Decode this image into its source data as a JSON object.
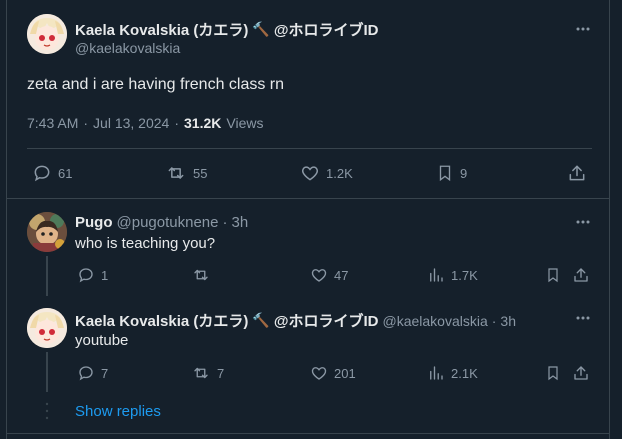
{
  "main_tweet": {
    "display_name": "Kaela Kovalskia (カエラ)",
    "name_emoji": "🔨",
    "affiliation": "@ホロライブID",
    "handle": "@kaelakovalskia",
    "text": "zeta and i are having french class rn",
    "time": "7:43 AM",
    "separator": "·",
    "date": "Jul 13, 2024",
    "views_count": "31.2K",
    "views_label": "Views",
    "stats": {
      "replies": "61",
      "reposts": "55",
      "likes": "1.2K",
      "bookmarks": "9"
    }
  },
  "replies": [
    {
      "display_name": "Pugo",
      "handle": "@pugotuknene",
      "separator": "·",
      "time_ago": "3h",
      "text": "who is teaching you?",
      "stats": {
        "replies": "1",
        "reposts": "",
        "likes": "47",
        "views": "1.7K"
      }
    },
    {
      "display_name": "Kaela Kovalskia (カエラ)",
      "name_emoji": "🔨",
      "affiliation": "@ホロライブID",
      "handle": "@kaelakovalskia",
      "separator": "·",
      "time_ago": "3h",
      "text": "youtube",
      "stats": {
        "replies": "7",
        "reposts": "7",
        "likes": "201",
        "views": "2.1K"
      }
    }
  ],
  "show_replies_label": "Show replies",
  "colors": {
    "background": "#15202b",
    "border": "#38444d",
    "text": "#e7e9ea",
    "muted": "#8b98a5",
    "accent": "#1d9bf0"
  }
}
